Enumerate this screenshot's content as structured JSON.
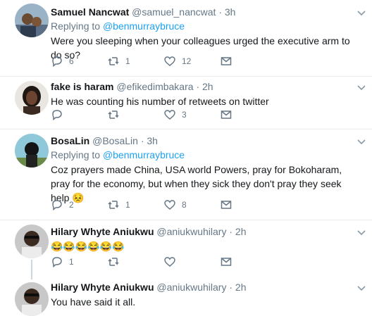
{
  "tweets": [
    {
      "name": "Samuel Nancwat",
      "handle": "@samuel_nancwat",
      "time": "3h",
      "replying_label": "Replying to",
      "replying_to": "@benmurraybruce",
      "text": "Were you sleeping when your colleagues urged the executive arm to do so?",
      "replies": "6",
      "retweets": "1",
      "likes": "12"
    },
    {
      "name": "fake is haram",
      "handle": "@efikedimbakara",
      "time": "2h",
      "text": "He was counting his number of retweets on twitter",
      "replies": "",
      "retweets": "",
      "likes": "3"
    },
    {
      "name": "BosaLin",
      "handle": "@BosaLin",
      "time": "3h",
      "replying_label": "Replying to",
      "replying_to": "@benmurraybruce",
      "text": "Coz prayers made China, USA world Powers, pray for Bokoharam, pray for the economy, but when they sick they don't pray they seek help 😣",
      "replies": "2",
      "retweets": "1",
      "likes": "8"
    },
    {
      "name": "Hilary Whyte Aniukwu",
      "handle": "@aniukwuhilary",
      "time": "2h",
      "text": "😂😂😂😂😂😂",
      "replies": "1",
      "retweets": "",
      "likes": ""
    },
    {
      "name": "Hilary Whyte Aniukwu",
      "handle": "@aniukwuhilary",
      "time": "2h",
      "text": "You have said it all."
    }
  ],
  "separator": "·",
  "colors": {
    "link": "#1da1f2",
    "secondary": "#657786",
    "border": "#e6ecf0"
  }
}
